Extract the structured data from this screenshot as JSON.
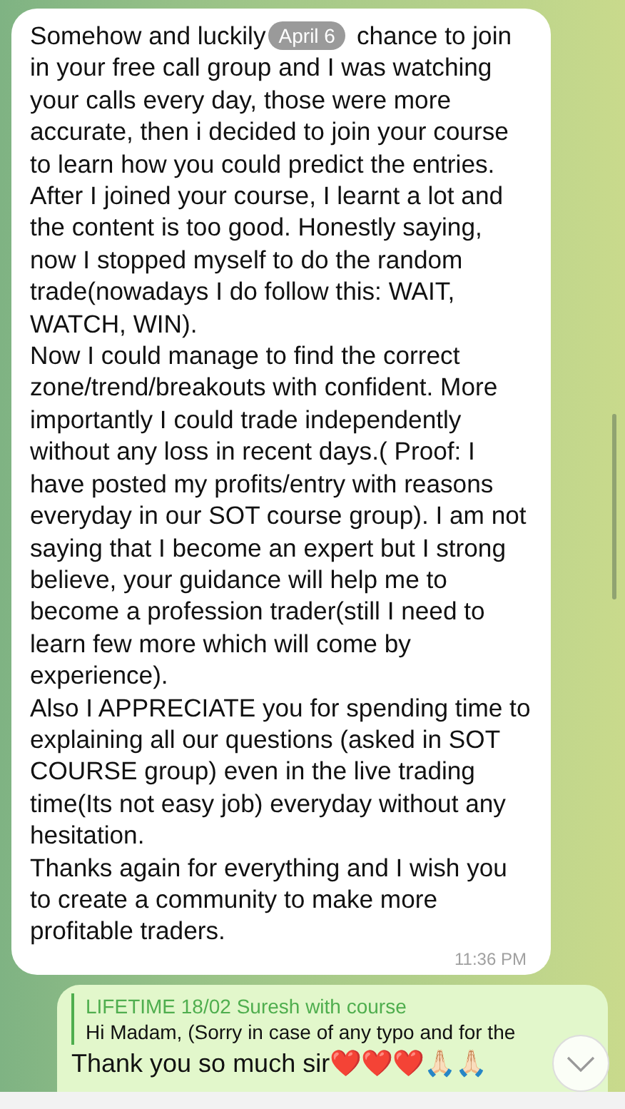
{
  "incoming_message": {
    "paragraphs": [
      {
        "before": "Somehow and luckily",
        "date_chip": "April 6",
        "after": "chance to join",
        "continued": "in your free call group and I was watching your calls every day, those were more accurate, then i decided to join your course to learn how you could predict the entries."
      },
      {
        "text": "After I joined your course, I learnt a lot and the content is too good. Honestly saying, now I stopped myself to do the random trade(nowadays I do follow this: WAIT, WATCH, WIN)."
      },
      {
        "text": "Now I could manage to find the correct zone/trend/breakouts with confident. More importantly I could trade independently without any loss in recent days.( Proof: I have posted my profits/entry with reasons everyday in our SOT course group). I am not saying that I become an expert but I strong believe, your guidance will help me to become a profession trader(still I need to learn few more which will come by experience)."
      },
      {
        "text": "Also I APPRECIATE you for spending time to explaining all our questions (asked in SOT COURSE group) even in the live trading time(Its not easy job) everyday without any hesitation."
      },
      {
        "text": "Thanks again for everything and I wish you to create a community to make more profitable traders."
      }
    ],
    "time": "11:36 PM"
  },
  "outgoing_message": {
    "reply_to": {
      "name": "LIFETIME 18/02 Suresh with course",
      "preview": "Hi Madam, (Sorry in case of any typo and for the"
    },
    "text": "Thank you so much sir❤️❤️❤️🙏🏻🙏🏻"
  }
}
